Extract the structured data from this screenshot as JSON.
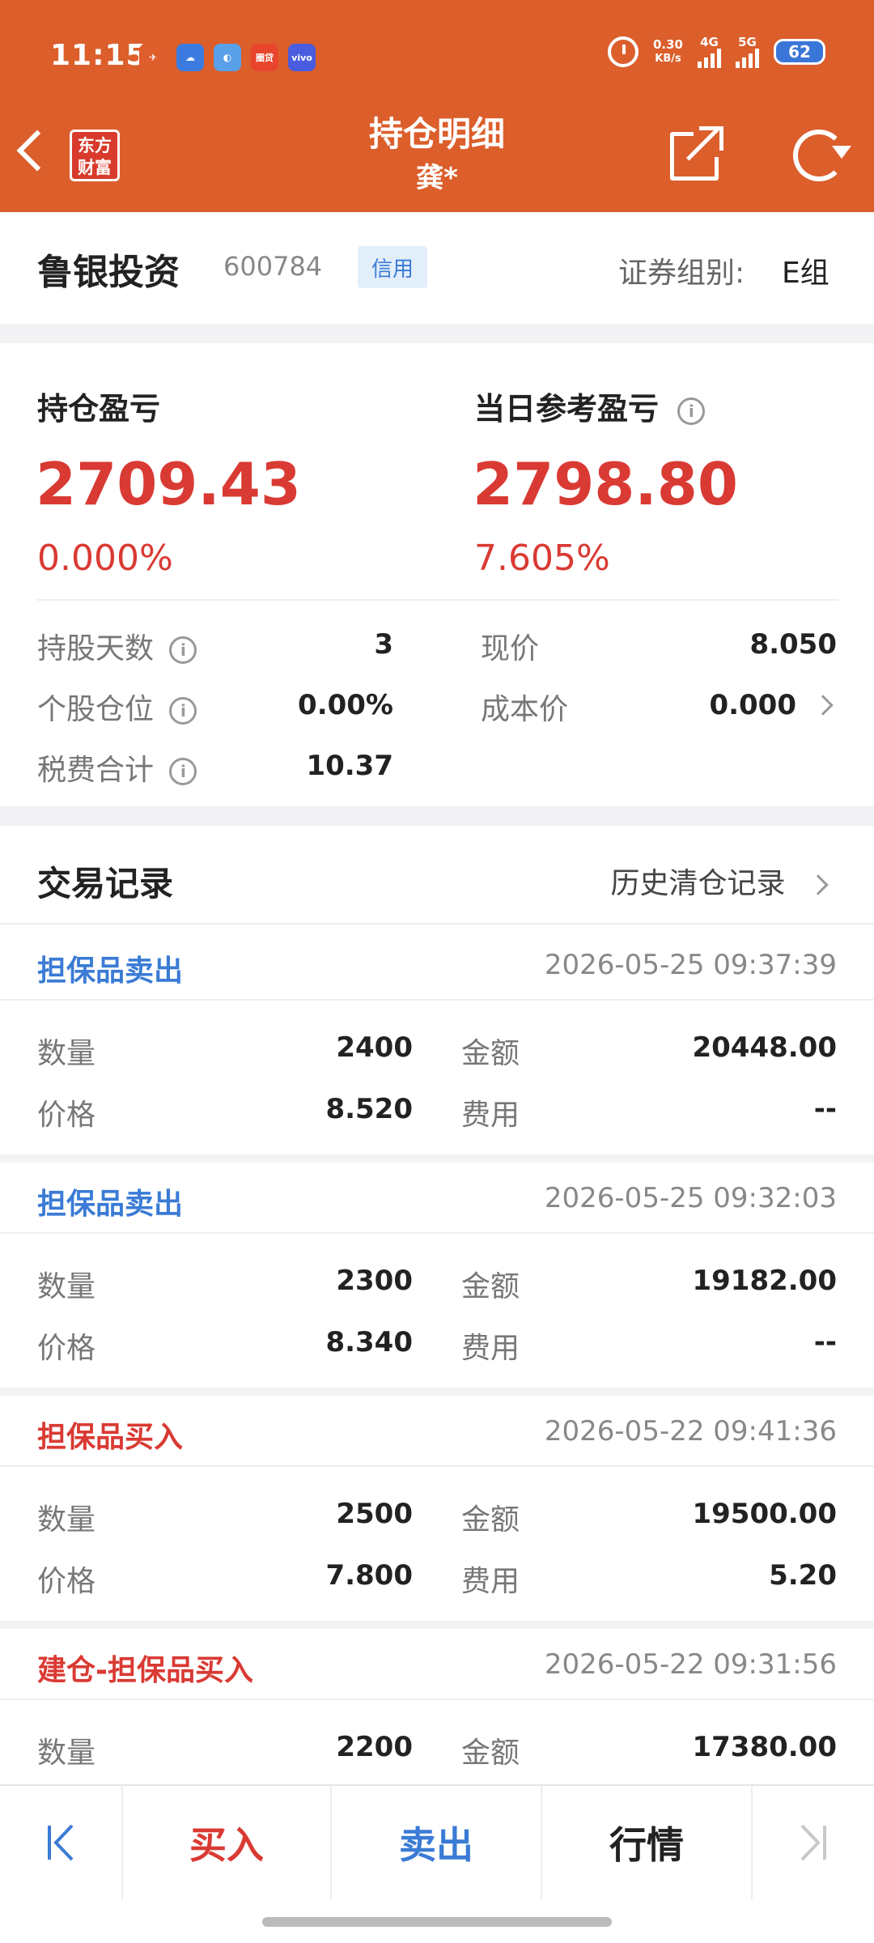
{
  "status_bar": {
    "time": "11:15",
    "app_icons": [
      {
        "name": "telegram-icon",
        "color": "#e05d2c",
        "label": ""
      },
      {
        "name": "cloud-app-icon",
        "color": "#3b7be0",
        "label": ""
      },
      {
        "name": "moon-app-icon",
        "color": "#5aa0e8",
        "label": ""
      },
      {
        "name": "app-icon-red",
        "color": "#e8452c",
        "label": "圈贷"
      },
      {
        "name": "vivo-icon",
        "color": "#4a5de0",
        "label": "vivo"
      }
    ],
    "speed_value": "0.30",
    "speed_unit": "KB/s",
    "net_4g": "4G",
    "net_5g": "5G",
    "battery": "62"
  },
  "header": {
    "logo_line1": "东方",
    "logo_line2": "财富",
    "title": "持仓明细",
    "subtitle": "龚*"
  },
  "stock": {
    "name": "鲁银投资",
    "code": "600784",
    "badge": "信用",
    "group_label": "证券组别:",
    "group_value": "E组"
  },
  "pl": {
    "hold_label": "持仓盈亏",
    "hold_value": "2709.43",
    "hold_pct": "0.000%",
    "day_label": "当日参考盈亏",
    "day_value": "2798.80",
    "day_pct": "7.605%",
    "info_glyph": "i"
  },
  "stats": {
    "days_label": "持股天数",
    "days_value": "3",
    "price_label": "现价",
    "price_value": "8.050",
    "position_label": "个股仓位",
    "position_value": "0.00%",
    "cost_label": "成本价",
    "cost_value": "0.000",
    "tax_label": "税费合计",
    "tax_value": "10.37"
  },
  "trades": {
    "title": "交易记录",
    "history_link": "历史清仓记录",
    "qty_label": "数量",
    "price_label": "价格",
    "amount_label": "金额",
    "fee_label": "费用",
    "records": [
      {
        "type": "担保品卖出",
        "color": "#3a7bd5",
        "time": "2026-05-25  09:37:39",
        "qty": "2400",
        "price": "8.520",
        "amount": "20448.00",
        "fee": "--"
      },
      {
        "type": "担保品卖出",
        "color": "#3a7bd5",
        "time": "2026-05-25  09:32:03",
        "qty": "2300",
        "price": "8.340",
        "amount": "19182.00",
        "fee": "--"
      },
      {
        "type": "担保品买入",
        "color": "#d93a33",
        "time": "2026-05-22  09:41:36",
        "qty": "2500",
        "price": "7.800",
        "amount": "19500.00",
        "fee": "5.20"
      },
      {
        "type": "建仓-担保品买入",
        "color": "#d93a33",
        "time": "2026-05-22  09:31:56",
        "qty": "2200",
        "price": "",
        "amount": "17380.00",
        "fee": ""
      }
    ]
  },
  "bottom_bar": {
    "buy": "买入",
    "sell": "卖出",
    "quote": "行情",
    "buy_color": "#d93a33",
    "sell_color": "#3a7bd5"
  }
}
